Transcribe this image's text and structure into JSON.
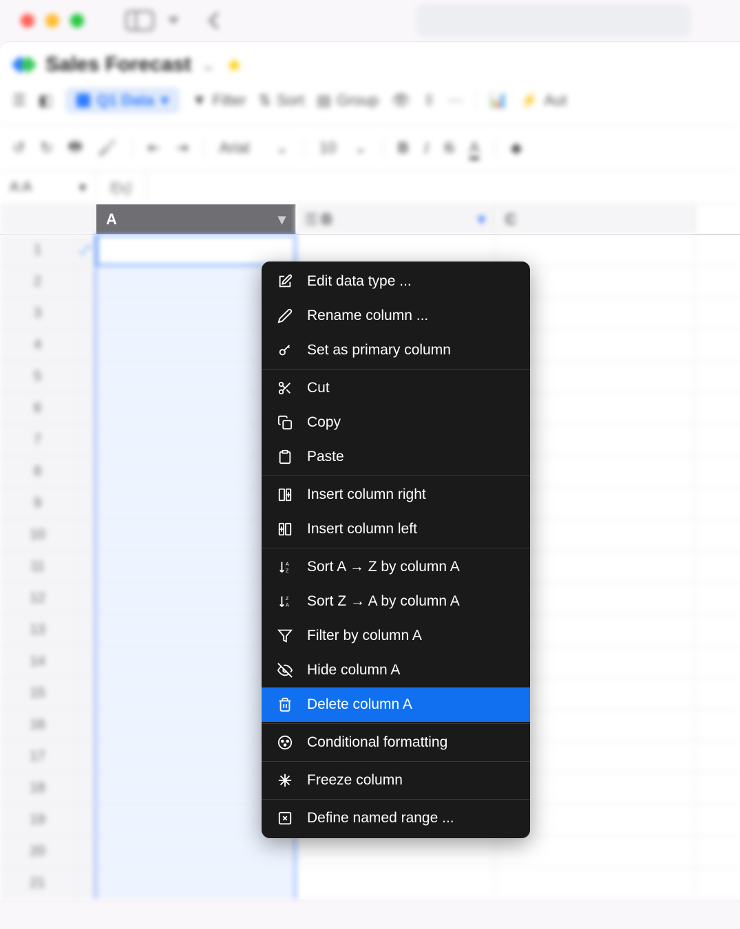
{
  "doc": {
    "title": "Sales Forecast"
  },
  "toolbar": {
    "view_name": "Q1 Data",
    "filter": "Filter",
    "sort": "Sort",
    "group": "Group",
    "automate_partial": "Aut",
    "font_name": "Arial",
    "font_size": "10",
    "bold": "B",
    "italic": "I",
    "strike": "S",
    "text_color": "A"
  },
  "formula": {
    "name_box": "A:A",
    "fx": "f(x)"
  },
  "columns": {
    "a": "A",
    "b": "B",
    "c": "C"
  },
  "rows": [
    "1",
    "2",
    "3",
    "4",
    "5",
    "6",
    "7",
    "8",
    "9",
    "10",
    "11",
    "12",
    "13",
    "14",
    "15",
    "16",
    "17",
    "18",
    "19",
    "20",
    "21"
  ],
  "menu": {
    "edit_data_type": "Edit data type ...",
    "rename": "Rename column ...",
    "set_primary": "Set as primary column",
    "cut": "Cut",
    "copy": "Copy",
    "paste": "Paste",
    "insert_right": "Insert column right",
    "insert_left": "Insert column left",
    "sort_az": "Sort A → Z by column A",
    "sort_za": "Sort Z → A by column A",
    "filter": "Filter by column A",
    "hide": "Hide column A",
    "delete": "Delete column A",
    "cond_format": "Conditional formatting",
    "freeze": "Freeze column",
    "named_range": "Define named range ..."
  }
}
